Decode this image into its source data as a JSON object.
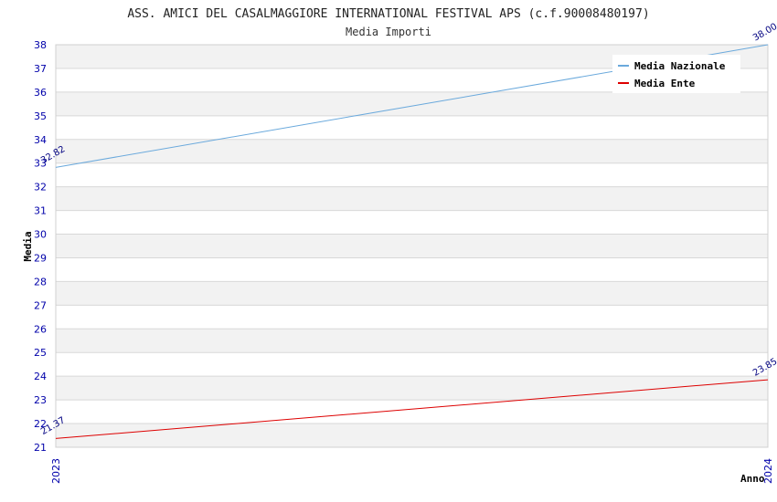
{
  "chart_data": {
    "type": "line",
    "title": "ASS. AMICI DEL CASALMAGGIORE INTERNATIONAL FESTIVAL APS (c.f.90008480197)",
    "subtitle": "Media Importi",
    "xlabel": "Anno",
    "ylabel": "Media",
    "x": [
      "2023",
      "2024"
    ],
    "ylim": [
      21,
      38
    ],
    "yticks": [
      21,
      22,
      23,
      24,
      25,
      26,
      27,
      28,
      29,
      30,
      31,
      32,
      33,
      34,
      35,
      36,
      37,
      38
    ],
    "grid": "alternating horizontal bands",
    "legend_position": "top-right",
    "series": [
      {
        "name": "Media Nazionale",
        "values": [
          32.82,
          38.0
        ],
        "labels": [
          "32.82",
          "38.00"
        ],
        "color": "#6aa9dc"
      },
      {
        "name": "Media Ente",
        "values": [
          21.37,
          23.85
        ],
        "labels": [
          "21.37",
          "23.85"
        ],
        "color": "#dd0000"
      }
    ]
  }
}
